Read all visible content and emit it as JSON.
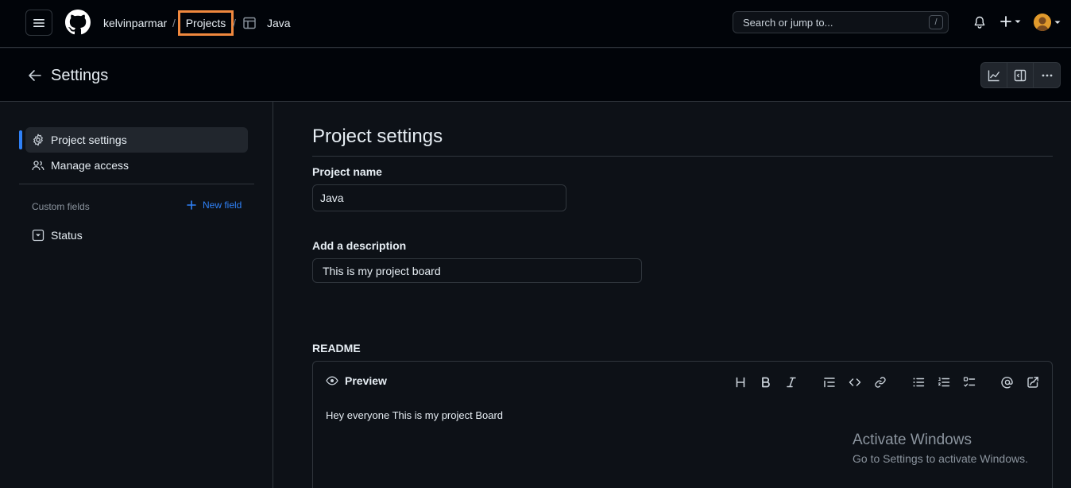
{
  "header": {
    "owner": "kelvinparmar",
    "separator": "/",
    "projects_link": "Projects",
    "project_name": "Java",
    "search_placeholder": "Search or jump to...",
    "search_shortcut": "/"
  },
  "settings_header": {
    "title": "Settings"
  },
  "sidebar": {
    "items": [
      {
        "label": "Project settings",
        "icon": "gear-icon",
        "active": true
      },
      {
        "label": "Manage access",
        "icon": "people-icon",
        "active": false
      }
    ],
    "custom_fields_label": "Custom fields",
    "new_field_label": "New field",
    "fields": [
      {
        "label": "Status",
        "icon": "single-select-icon"
      }
    ]
  },
  "main": {
    "title": "Project settings",
    "project_name_label": "Project name",
    "project_name_value": "Java",
    "description_label": "Add a description",
    "description_value": "This is my project board",
    "readme_label": "README",
    "preview_label": "Preview",
    "readme_text": "Hey everyone This is my project Board"
  },
  "watermark": {
    "line1": "Activate Windows",
    "line2": "Go to Settings to activate Windows."
  },
  "colors": {
    "accent": "#2f81f7",
    "highlight_box": "#f0883e",
    "background": "#0d1117"
  }
}
